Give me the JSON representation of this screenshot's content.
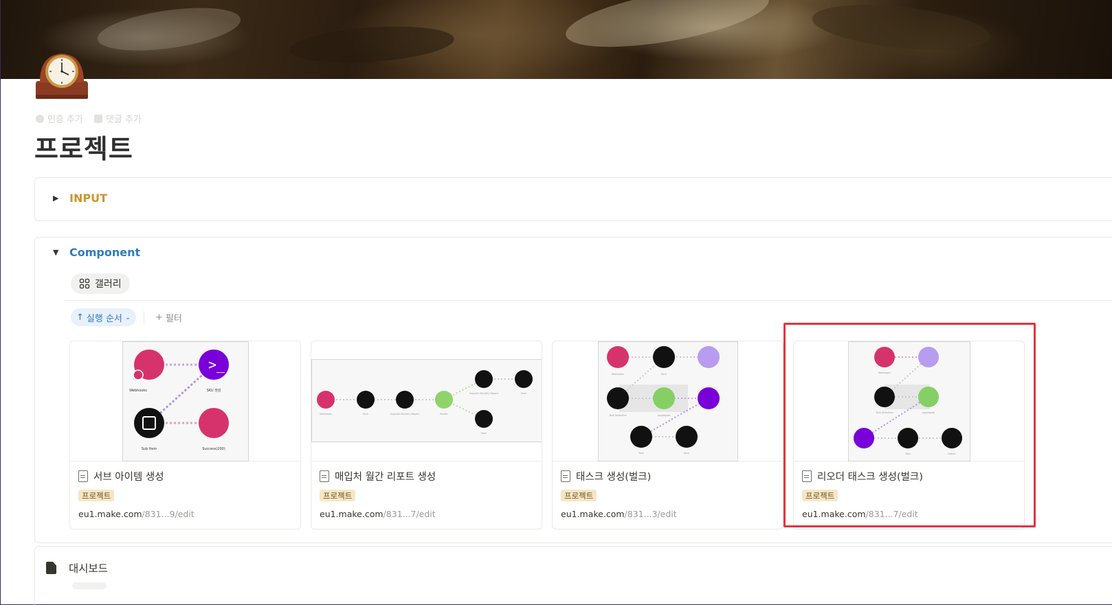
{
  "meta": {
    "add_verification": "인증 추가",
    "add_comment": "댓글 추가"
  },
  "page_title": "프로젝트",
  "toggles": {
    "input_label": "INPUT",
    "component_label": "Component"
  },
  "view": {
    "tab_label": "갤러리"
  },
  "toolbar": {
    "sort_label": "실행 순서",
    "filter_label": "필터"
  },
  "cards": [
    {
      "title": "서브 아이템 생성",
      "tag": "프로젝트",
      "url_main": "eu1.make.com",
      "url_rest": "/831...9/edit",
      "nodes": {
        "n1": "Webhooks",
        "n2": "SKU 생성",
        "n3": "Sub Item",
        "n4": "Success(200)"
      }
    },
    {
      "title": "매입처 월간 리포트 생성",
      "tag": "프로젝트",
      "url_main": "eu1.make.com",
      "url_rest": "/831...7/edit",
      "nodes": {
        "n1": "Webhooks",
        "n2": "Item",
        "n3": "Supplier Monthly Report",
        "n4": "Router",
        "n5": "Supplier Monthly Report",
        "n6": "Item",
        "n7": "Item"
      }
    },
    {
      "title": "태스크 생성(벌크)",
      "tag": "프로젝트",
      "url_main": "eu1.make.com",
      "url_rest": "/831...3/edit",
      "nodes": {
        "n1": "Webhooks",
        "n2": "Item",
        "n3": "Task Definition",
        "n4": "Aggregate",
        "n5": "Task",
        "n6": "Item"
      }
    },
    {
      "title": "리오더 태스크 생성(벌크)",
      "tag": "프로젝트",
      "url_main": "eu1.make.com",
      "url_rest": "/831...7/edit",
      "nodes": {
        "n1": "Webhooks",
        "n2": "Task Definition",
        "n3": "Aggregate",
        "n4": "Task",
        "n5": "Notion"
      }
    }
  ],
  "dashboard": {
    "label": "대시보드"
  },
  "colors": {
    "webhook": "#d6336c",
    "terminal": "#7a00d9",
    "notion": "#111111",
    "router": "#8fd46b",
    "aggregate": "#86cf64",
    "flow": "#a985e0",
    "highlight": "#e8313f"
  }
}
